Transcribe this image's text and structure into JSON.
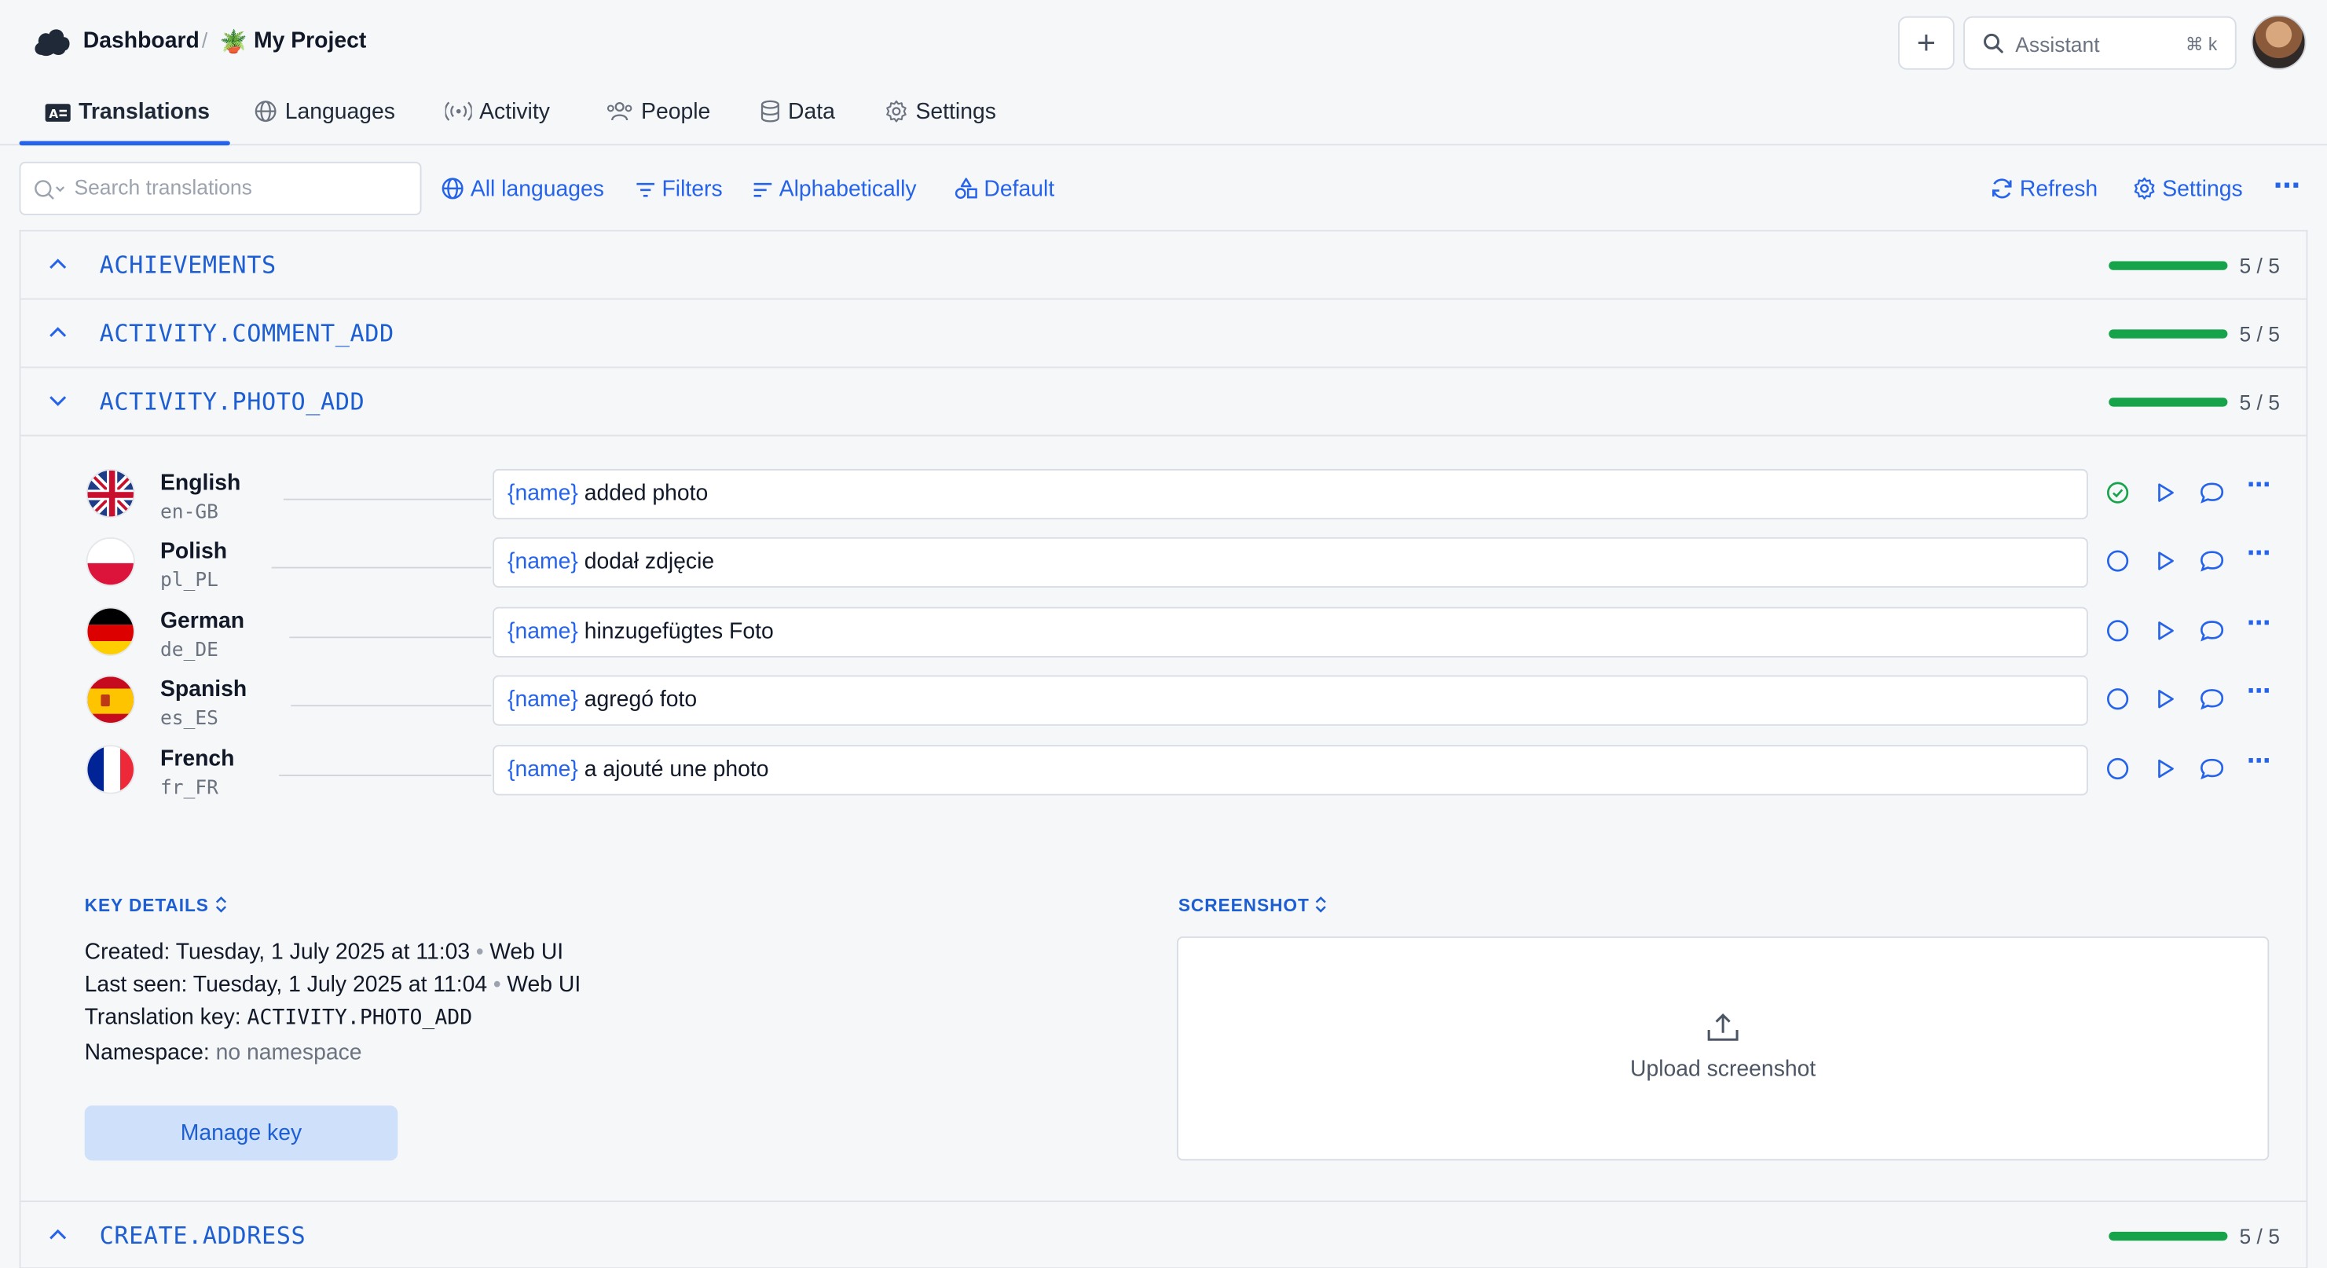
{
  "header": {
    "breadcrumb_root": "Dashboard",
    "separator": "/",
    "project_icon": "🪴",
    "project": "My Project",
    "add_label": "+",
    "assistant_label": "Assistant",
    "assistant_shortcut": "⌘ k"
  },
  "tabs": [
    {
      "label": "Translations",
      "icon": "translations-icon",
      "active": true
    },
    {
      "label": "Languages",
      "icon": "globe-icon"
    },
    {
      "label": "Activity",
      "icon": "activity-icon"
    },
    {
      "label": "People",
      "icon": "people-icon"
    },
    {
      "label": "Data",
      "icon": "database-icon"
    },
    {
      "label": "Settings",
      "icon": "gear-icon"
    }
  ],
  "toolbar": {
    "search_placeholder": "Search translations",
    "all_languages": "All languages",
    "filters": "Filters",
    "sort": "Alphabetically",
    "view": "Default",
    "refresh": "Refresh",
    "settings": "Settings",
    "more": "⋯"
  },
  "keys": [
    {
      "name": "ACHIEVEMENTS",
      "count": "5 / 5",
      "progress": 1.0,
      "expanded": false
    },
    {
      "name": "ACTIVITY.COMMENT_ADD",
      "count": "5 / 5",
      "progress": 1.0,
      "expanded": false
    },
    {
      "name": "ACTIVITY.PHOTO_ADD",
      "count": "5 / 5",
      "progress": 1.0,
      "expanded": true
    },
    {
      "name": "CREATE.ADDRESS",
      "count": "5 / 5",
      "progress": 1.0,
      "expanded": false
    }
  ],
  "translations": [
    {
      "language": "English",
      "code": "en-GB",
      "placeholder": "{name}",
      "text": " added photo",
      "state": "reviewed"
    },
    {
      "language": "Polish",
      "code": "pl_PL",
      "placeholder": "{name}",
      "text": " dodał zdjęcie",
      "state": "translated"
    },
    {
      "language": "German",
      "code": "de_DE",
      "placeholder": "{name}",
      "text": " hinzugefügtes Foto",
      "state": "translated"
    },
    {
      "language": "Spanish",
      "code": "es_ES",
      "placeholder": "{name}",
      "text": " agregó foto",
      "state": "translated"
    },
    {
      "language": "French",
      "code": "fr_FR",
      "placeholder": "{name}",
      "text": " a ajouté une photo",
      "state": "translated"
    }
  ],
  "key_details": {
    "title": "KEY DETAILS",
    "created_label": "Created:",
    "created_value": "Tuesday, 1 July 2025 at 11:03",
    "created_source": "Web UI",
    "last_seen_label": "Last seen:",
    "last_seen_value": "Tuesday, 1 July 2025 at 11:04",
    "last_seen_source": "Web UI",
    "key_label": "Translation key:",
    "key_value": "ACTIVITY.PHOTO_ADD",
    "namespace_label": "Namespace:",
    "namespace_value": "no namespace",
    "bullet": "•",
    "manage_button": "Manage key"
  },
  "screenshot": {
    "title": "SCREENSHOT",
    "upload_label": "Upload screenshot"
  },
  "colors": {
    "accent": "#2563eb",
    "progress": "#16a34a",
    "reviewed": "#16a34a"
  }
}
